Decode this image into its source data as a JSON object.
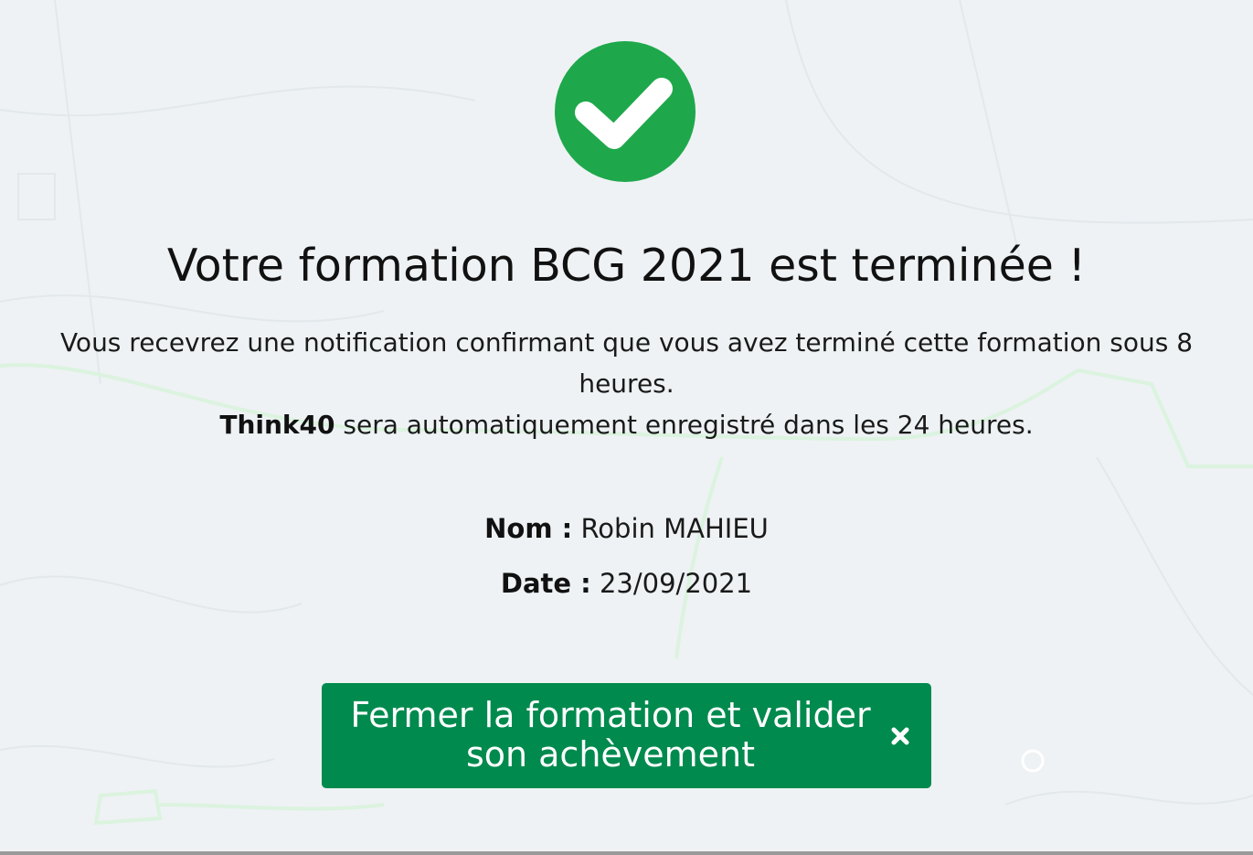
{
  "page": {
    "title": "Votre formation BCG 2021 est terminée !",
    "message_line1": "Vous recevrez une notification confirmant que vous avez terminé cette formation sous 8 heures.",
    "message_org": "Think40",
    "message_line2_rest": " sera automatiquement enregistré dans les 24 heures."
  },
  "details": {
    "name_label": "Nom :",
    "name_value": "Robin MAHIEU",
    "date_label": "Date :",
    "date_value": "23/09/2021"
  },
  "action": {
    "button_label": "Fermer la formation et valider son achèvement",
    "button_icon": "close-icon"
  },
  "icons": {
    "status": "check-circle-icon"
  },
  "colors": {
    "success_green": "#1ea84b",
    "button_green": "#008a4e",
    "background": "#eef2f4"
  }
}
